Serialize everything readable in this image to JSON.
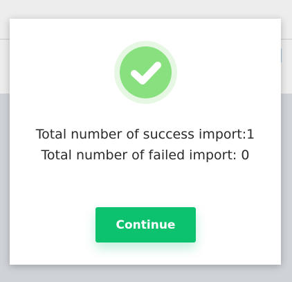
{
  "dialog": {
    "status_icon": "check-circle-icon",
    "success_text": "Total number of success import:1",
    "failed_text": "Total number of failed import: 0",
    "continue_label": "Continue"
  },
  "colors": {
    "success_green": "#88e07f",
    "success_green_light": "#e6f8e3",
    "button_green": "#0cc26f"
  }
}
